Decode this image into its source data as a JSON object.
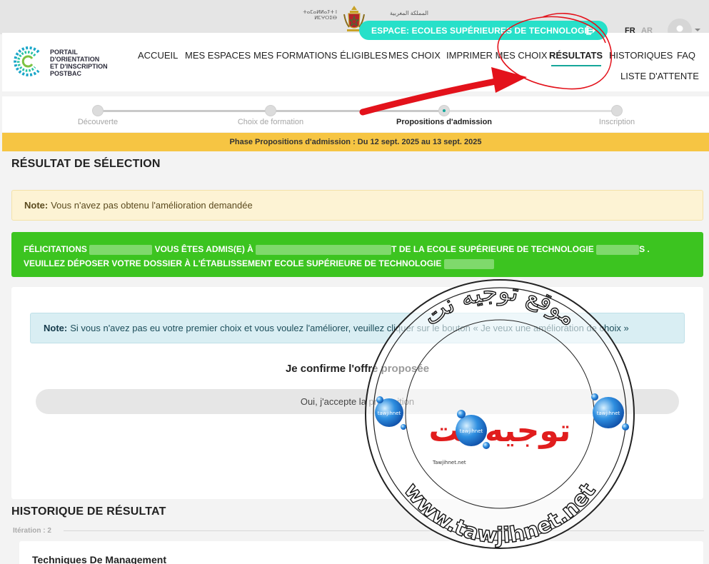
{
  "gov": {
    "left_text": "ⵜⴰⵎⴰⵍⵍⴰⵢⵜ ⵏ ⵍⵎⵖⵔⵉⴱ",
    "right_text": "المملكة المغربية"
  },
  "espace": {
    "label": "ESPACE: ECOLES SUPÉRIEURES DE TECHNOLOGIE",
    "icon": "logout-icon"
  },
  "lang": {
    "fr": "FR",
    "ar": "AR"
  },
  "logo": {
    "lines": [
      "PORTAIL",
      "D'ORIENTATION",
      "ET D'INSCRIPTION",
      "POSTBAC"
    ]
  },
  "nav": {
    "accueil": "ACCUEIL",
    "espaces": "MES ESPACES",
    "formations": "MES FORMATIONS ÉLIGIBLES",
    "choix": "MES CHOIX",
    "imprimer": "IMPRIMER MES CHOIX",
    "resultats": "RÉSULTATS",
    "historiques": "HISTORIQUES",
    "faq": "FAQ",
    "attente": "LISTE D'ATTENTE"
  },
  "stepper": {
    "steps": [
      "Découverte",
      "Choix de formation",
      "Propositions d'admission",
      "Inscription"
    ],
    "current_index": 2
  },
  "phase": {
    "text": "Phase Propositions d'admission : Du 12 sept. 2025 au 13 sept. 2025"
  },
  "result": {
    "title": "RÉSULTAT DE SÉLECTION",
    "note_label": "Note:",
    "note_text": "Vous n'avez pas obtenu l'amélioration demandée",
    "success_prefix": "FÉLICITATIONS",
    "success_mid": "VOUS ÊTES ADMIS(E) À",
    "success_suffix": "T DE LA ECOLE SUPÉRIEURE DE TECHNOLOGIE",
    "success_end": "S .",
    "success_line2": "VEUILLEZ DÉPOSER VOTRE DOSSIER À L'ÉTABLISSEMENT",
    "success_line2_bold": "ECOLE SUPÉRIEURE DE TECHNOLOGIE"
  },
  "confirm": {
    "note_label": "Note:",
    "note_text": "Si vous n'avez pas eu votre premier choix et vous voulez l'améliorer, veuillez cliquer sur le bouton « Je veux une amélioration de choix »",
    "title": "Je confirme l'offre proposée",
    "accept_label": "Oui, j'accepte la proposition"
  },
  "history": {
    "title": "HISTORIQUE DE RÉSULTAT",
    "iteration": "Itération : 2",
    "first_item": "Techniques De Management"
  },
  "watermark": {
    "arabic_top": "موقع توجيه نت",
    "arabic_center": "توجيه نت",
    "url": "www.tawjihnet.net",
    "badge_text": "tawjihnet",
    "small_url": "Tawjihnet.net"
  },
  "colors": {
    "accent": "#27e0c9",
    "underline": "#16a79a",
    "phase": "#f6c543",
    "success": "#3cc420",
    "annotation": "#e3121b"
  }
}
